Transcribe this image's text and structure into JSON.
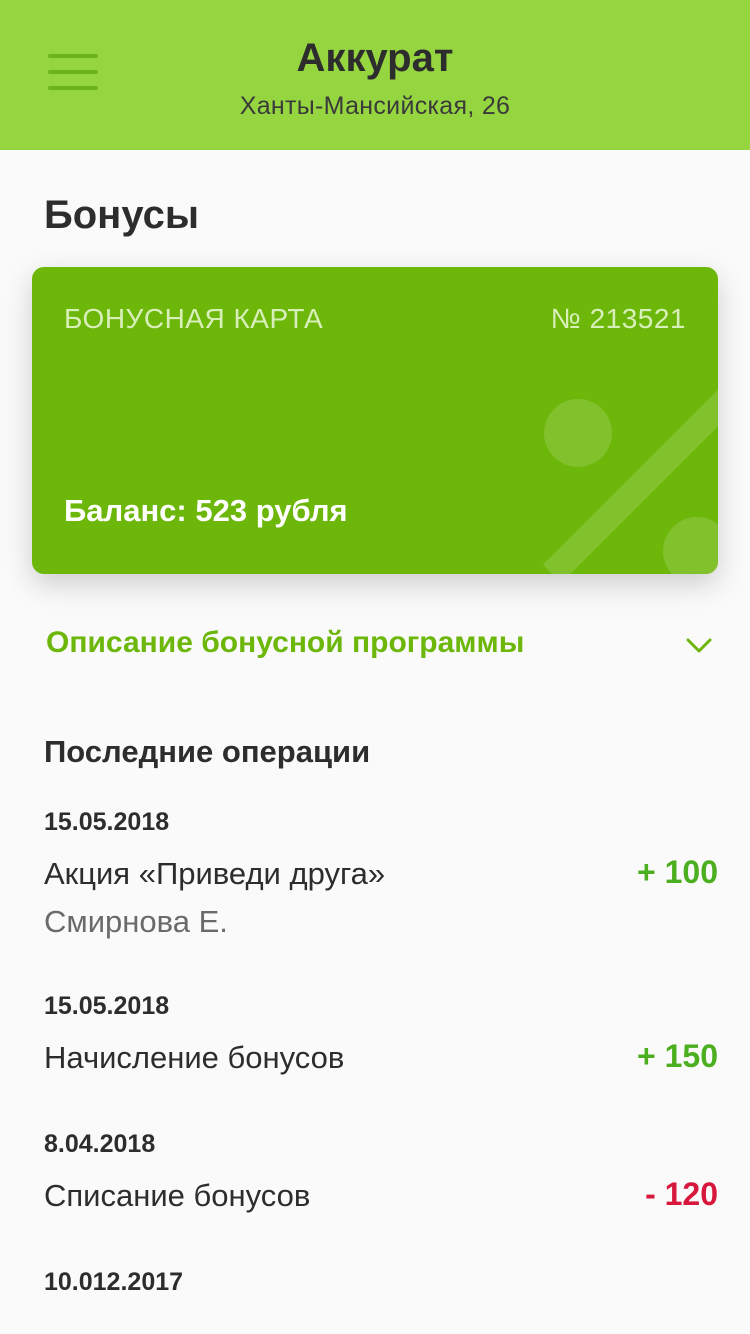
{
  "header": {
    "title": "Аккурат",
    "address": "Ханты-Мансийская, 26",
    "menu_icon": "hamburger-menu-icon"
  },
  "page": {
    "title": "Бонусы"
  },
  "card": {
    "label": "БОНУСНАЯ КАРТА",
    "number": "№ 213521",
    "balance": "Баланс: 523 рубля"
  },
  "program": {
    "label": "Описание бонусной программы",
    "icon": "chevron-down-icon"
  },
  "operations": {
    "title": "Последние операции",
    "items": [
      {
        "date": "15.05.2018",
        "name": "Акция «Приведи друга»",
        "sub": "Смирнова Е.",
        "amount": "+ 100",
        "sign": "positive"
      },
      {
        "date": "15.05.2018",
        "name": "Начисление бонусов",
        "sub": "",
        "amount": "+ 150",
        "sign": "positive"
      },
      {
        "date": "8.04.2018",
        "name": "Списание бонусов",
        "sub": "",
        "amount": "- 120",
        "sign": "negative"
      },
      {
        "date": "10.012.2017",
        "name": "",
        "sub": "",
        "amount": "",
        "sign": ""
      }
    ]
  },
  "colors": {
    "header_bg": "#95d540",
    "card_bg": "#6cb70a",
    "accent": "#6cb70a",
    "positive": "#4caf1f",
    "negative": "#d8173c"
  }
}
